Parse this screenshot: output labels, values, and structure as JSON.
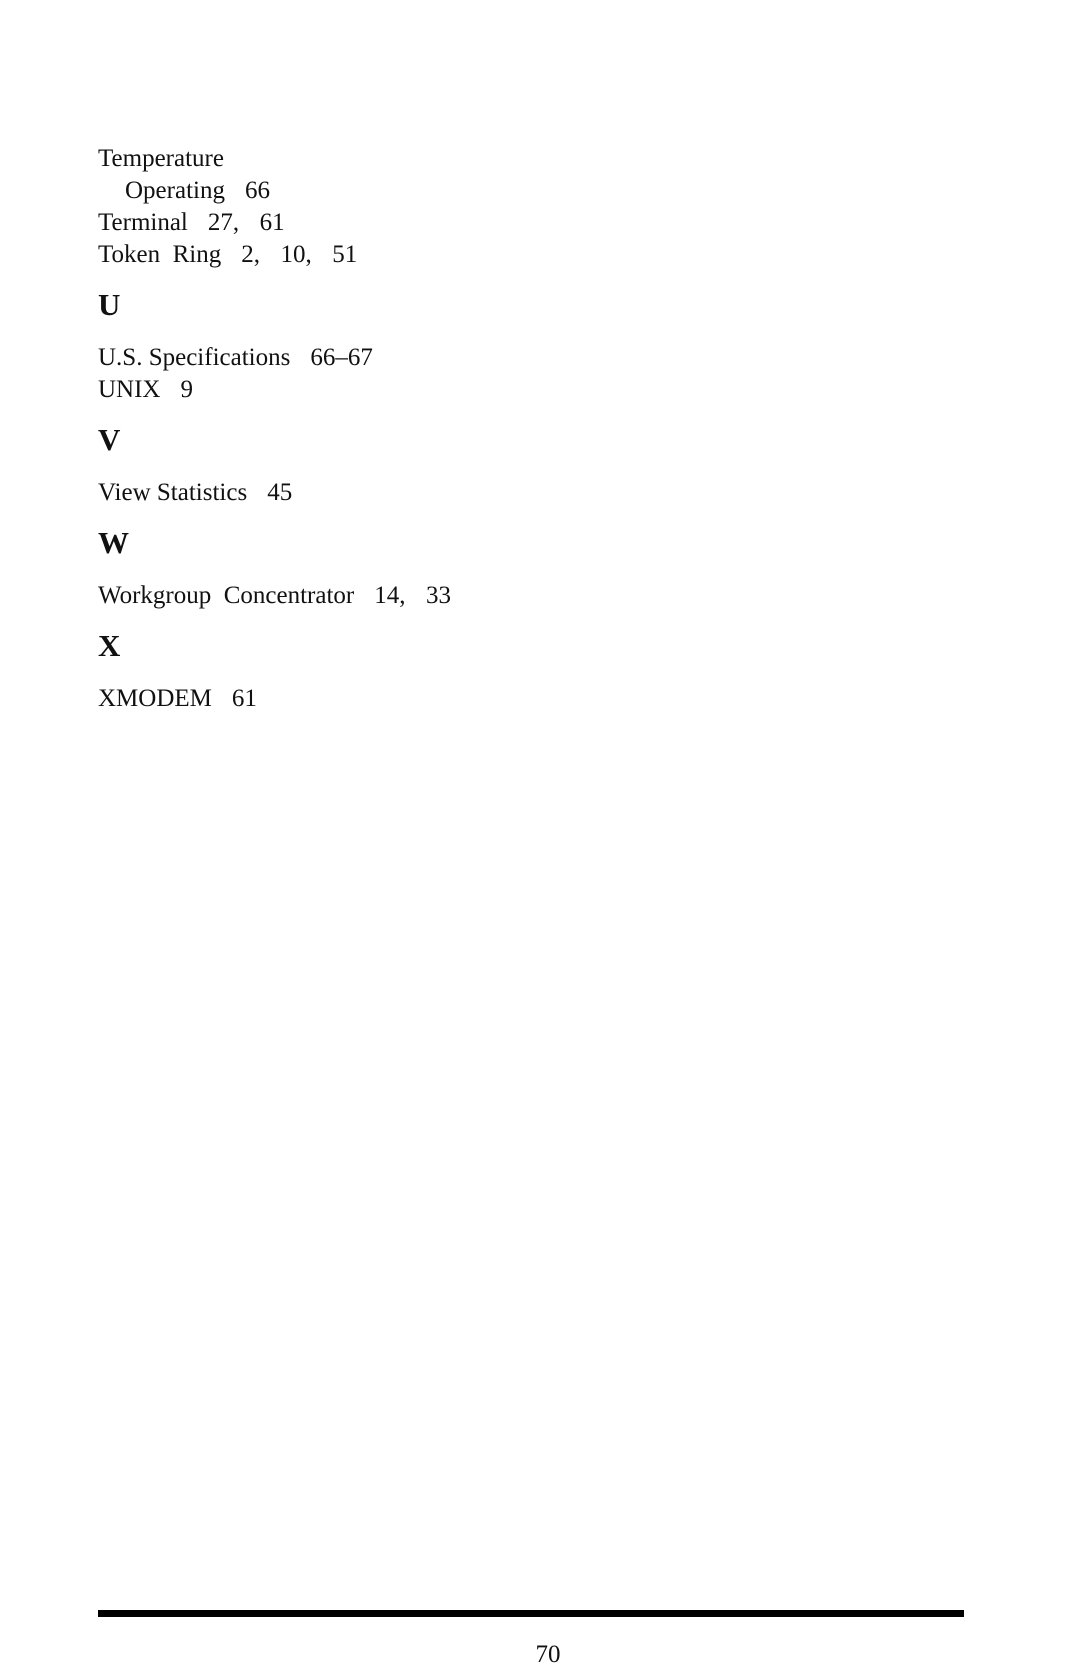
{
  "index": {
    "sections": [
      {
        "letter": "",
        "entries": [
          {
            "term": "Temperature",
            "pages": "",
            "level": 0
          },
          {
            "term": "Operating",
            "pages": "66",
            "level": 1
          },
          {
            "term": "Terminal",
            "pages": "27,  61",
            "level": 0
          },
          {
            "term": "Token  Ring",
            "pages": "2,  10,  51",
            "level": 0
          }
        ]
      },
      {
        "letter": "U",
        "entries": [
          {
            "term": "U.S. Specifications",
            "pages": "66–67",
            "level": 0
          },
          {
            "term": "UNIX",
            "pages": "9",
            "level": 0
          }
        ]
      },
      {
        "letter": "V",
        "entries": [
          {
            "term": "View Statistics",
            "pages": "45",
            "level": 0
          }
        ]
      },
      {
        "letter": "W",
        "entries": [
          {
            "term": "Workgroup  Concentrator",
            "pages": "14,  33",
            "level": 0
          }
        ]
      },
      {
        "letter": "X",
        "entries": [
          {
            "term": "XMODEM",
            "pages": "61",
            "level": 0
          }
        ]
      }
    ]
  },
  "footer": {
    "page_number": "70"
  }
}
